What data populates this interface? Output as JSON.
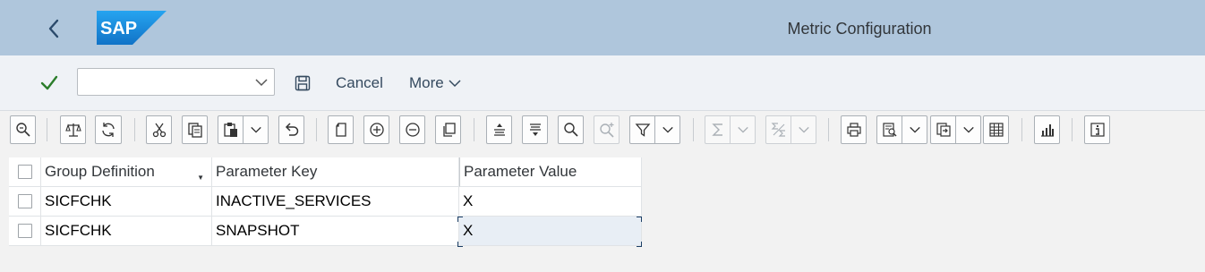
{
  "shell": {
    "title": "Metric Configuration",
    "logo_text": "SAP",
    "back_icon": "chevron-left-icon"
  },
  "actionbar": {
    "command_field": {
      "value": "",
      "placeholder": ""
    },
    "cancel_label": "Cancel",
    "more_label": "More"
  },
  "toolbar": {
    "buttons": [
      "details",
      "compare",
      "refresh",
      "cut",
      "copy",
      "paste",
      "undo",
      "new",
      "insert-row",
      "delete-row",
      "copy-row",
      "sort-ascending",
      "sort-descending",
      "find",
      "find-next",
      "filter",
      "sum",
      "subtotal",
      "print",
      "view",
      "export",
      "layout",
      "graphic",
      "information"
    ]
  },
  "table": {
    "columns": [
      "Group Definition",
      "Parameter Key",
      "Parameter Value"
    ],
    "rows": [
      {
        "group": "SICFCHK",
        "key": "INACTIVE_SERVICES",
        "value": "X"
      },
      {
        "group": "SICFCHK",
        "key": "SNAPSHOT",
        "value": "X"
      }
    ]
  },
  "colors": {
    "shell_bg": "#afc6dc",
    "logo_blue": "#1a8fe0",
    "ok_green": "#2b7d2b",
    "text_blue": "#354a5f"
  }
}
